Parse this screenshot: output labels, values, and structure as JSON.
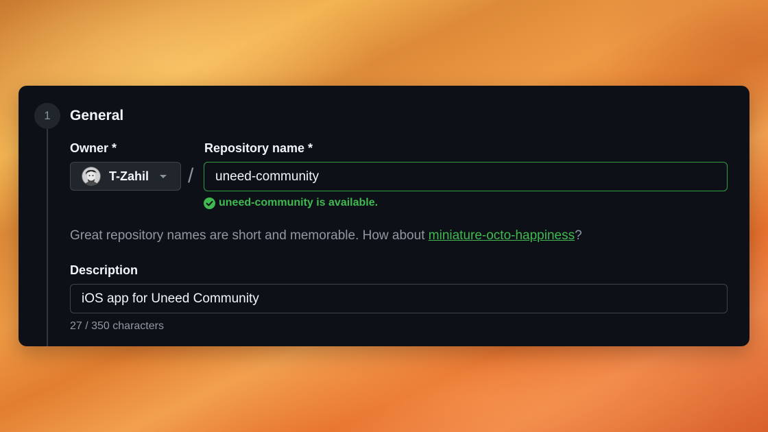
{
  "step": {
    "number": "1",
    "title": "General"
  },
  "owner": {
    "label": "Owner *",
    "selected": "T-Zahil",
    "avatar_icon": "user-avatar"
  },
  "separator": "/",
  "repository": {
    "label": "Repository name *",
    "value": "uneed-community",
    "status_text": "uneed-community is available.",
    "status_color": "#3fb950"
  },
  "hint": {
    "prefix": "Great repository names are short and memorable. How about ",
    "suggestion": "miniature-octo-happiness",
    "suffix": "?"
  },
  "description": {
    "label": "Description",
    "value": "iOS app for Uneed Community",
    "char_count": "27 / 350 characters"
  },
  "colors": {
    "card_bg": "#0d1117",
    "accent_green": "#3fb950",
    "border": "#3d444d",
    "muted_text": "#9198a1"
  }
}
